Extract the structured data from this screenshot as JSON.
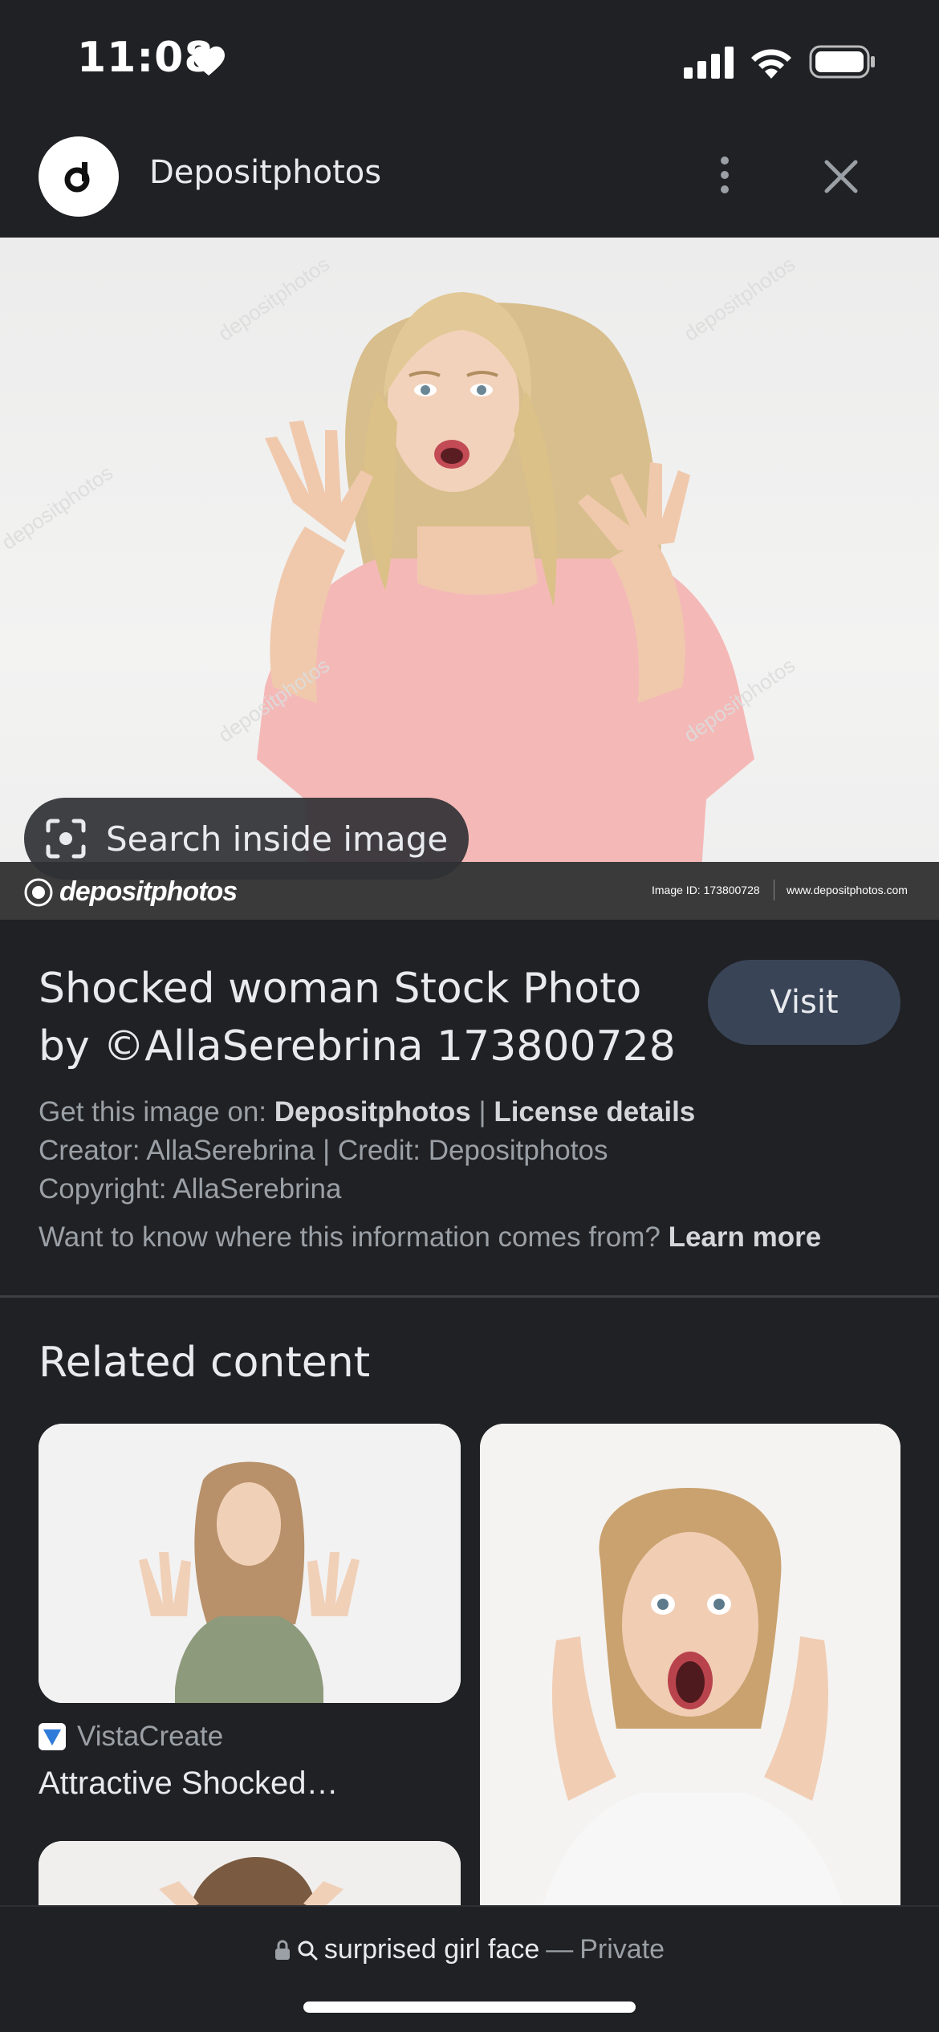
{
  "status_bar": {
    "time": "11:08"
  },
  "header": {
    "site_name": "Depositphotos"
  },
  "image": {
    "search_inside_label": "Search inside image",
    "watermark_brand": "depositphotos",
    "watermark_id": "Image ID: 173800728",
    "watermark_url": "www.depositphotos.com"
  },
  "info": {
    "title": "Shocked woman Stock Photo by ©AllaSerebrina 173800728",
    "visit_label": "Visit",
    "get_image_prefix": "Get this image on:",
    "get_image_source": "Depositphotos",
    "separator": "|",
    "license_link": "License details",
    "creator_line": "Creator: AllaSerebrina | Credit: Depositphotos",
    "copyright_line": "Copyright: AllaSerebrina",
    "info_question": "Want to know where this information comes from?",
    "learn_more": "Learn more"
  },
  "related": {
    "title": "Related content",
    "items": [
      {
        "source": "VistaCreate",
        "caption": "Attractive Shocked…"
      }
    ]
  },
  "bottom_bar": {
    "query": "surprised girl face",
    "separator": "—",
    "mode": "Private"
  },
  "colors": {
    "background": "#202124",
    "visit_button": "#394457",
    "pink_shirt": "#f4b9b7"
  }
}
